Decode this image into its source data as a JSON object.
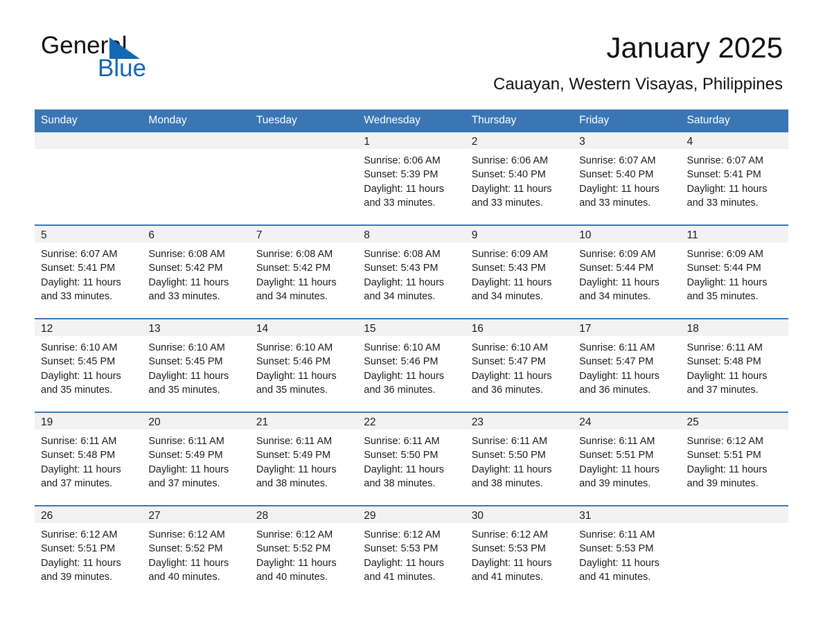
{
  "brand": {
    "name_part1": "General",
    "name_part2": "Blue",
    "accent_color": "#1268b3",
    "logo_icon": "triangle-icon"
  },
  "header": {
    "title": "January 2025",
    "subtitle": "Cauayan, Western Visayas, Philippines"
  },
  "theme": {
    "header_row_bg": "#3a76b4",
    "daynum_band_bg": "#f2f2f2",
    "row_divider": "#3a76b4"
  },
  "weekday_headers": [
    "Sunday",
    "Monday",
    "Tuesday",
    "Wednesday",
    "Thursday",
    "Friday",
    "Saturday"
  ],
  "weeks": [
    [
      {
        "day": "",
        "sunrise": "",
        "sunset": "",
        "daylight": "",
        "empty": true
      },
      {
        "day": "",
        "sunrise": "",
        "sunset": "",
        "daylight": "",
        "empty": true
      },
      {
        "day": "",
        "sunrise": "",
        "sunset": "",
        "daylight": "",
        "empty": true
      },
      {
        "day": "1",
        "sunrise": "Sunrise: 6:06 AM",
        "sunset": "Sunset: 5:39 PM",
        "daylight": "Daylight: 11 hours and 33 minutes."
      },
      {
        "day": "2",
        "sunrise": "Sunrise: 6:06 AM",
        "sunset": "Sunset: 5:40 PM",
        "daylight": "Daylight: 11 hours and 33 minutes."
      },
      {
        "day": "3",
        "sunrise": "Sunrise: 6:07 AM",
        "sunset": "Sunset: 5:40 PM",
        "daylight": "Daylight: 11 hours and 33 minutes."
      },
      {
        "day": "4",
        "sunrise": "Sunrise: 6:07 AM",
        "sunset": "Sunset: 5:41 PM",
        "daylight": "Daylight: 11 hours and 33 minutes."
      }
    ],
    [
      {
        "day": "5",
        "sunrise": "Sunrise: 6:07 AM",
        "sunset": "Sunset: 5:41 PM",
        "daylight": "Daylight: 11 hours and 33 minutes."
      },
      {
        "day": "6",
        "sunrise": "Sunrise: 6:08 AM",
        "sunset": "Sunset: 5:42 PM",
        "daylight": "Daylight: 11 hours and 33 minutes."
      },
      {
        "day": "7",
        "sunrise": "Sunrise: 6:08 AM",
        "sunset": "Sunset: 5:42 PM",
        "daylight": "Daylight: 11 hours and 34 minutes."
      },
      {
        "day": "8",
        "sunrise": "Sunrise: 6:08 AM",
        "sunset": "Sunset: 5:43 PM",
        "daylight": "Daylight: 11 hours and 34 minutes."
      },
      {
        "day": "9",
        "sunrise": "Sunrise: 6:09 AM",
        "sunset": "Sunset: 5:43 PM",
        "daylight": "Daylight: 11 hours and 34 minutes."
      },
      {
        "day": "10",
        "sunrise": "Sunrise: 6:09 AM",
        "sunset": "Sunset: 5:44 PM",
        "daylight": "Daylight: 11 hours and 34 minutes."
      },
      {
        "day": "11",
        "sunrise": "Sunrise: 6:09 AM",
        "sunset": "Sunset: 5:44 PM",
        "daylight": "Daylight: 11 hours and 35 minutes."
      }
    ],
    [
      {
        "day": "12",
        "sunrise": "Sunrise: 6:10 AM",
        "sunset": "Sunset: 5:45 PM",
        "daylight": "Daylight: 11 hours and 35 minutes."
      },
      {
        "day": "13",
        "sunrise": "Sunrise: 6:10 AM",
        "sunset": "Sunset: 5:45 PM",
        "daylight": "Daylight: 11 hours and 35 minutes."
      },
      {
        "day": "14",
        "sunrise": "Sunrise: 6:10 AM",
        "sunset": "Sunset: 5:46 PM",
        "daylight": "Daylight: 11 hours and 35 minutes."
      },
      {
        "day": "15",
        "sunrise": "Sunrise: 6:10 AM",
        "sunset": "Sunset: 5:46 PM",
        "daylight": "Daylight: 11 hours and 36 minutes."
      },
      {
        "day": "16",
        "sunrise": "Sunrise: 6:10 AM",
        "sunset": "Sunset: 5:47 PM",
        "daylight": "Daylight: 11 hours and 36 minutes."
      },
      {
        "day": "17",
        "sunrise": "Sunrise: 6:11 AM",
        "sunset": "Sunset: 5:47 PM",
        "daylight": "Daylight: 11 hours and 36 minutes."
      },
      {
        "day": "18",
        "sunrise": "Sunrise: 6:11 AM",
        "sunset": "Sunset: 5:48 PM",
        "daylight": "Daylight: 11 hours and 37 minutes."
      }
    ],
    [
      {
        "day": "19",
        "sunrise": "Sunrise: 6:11 AM",
        "sunset": "Sunset: 5:48 PM",
        "daylight": "Daylight: 11 hours and 37 minutes."
      },
      {
        "day": "20",
        "sunrise": "Sunrise: 6:11 AM",
        "sunset": "Sunset: 5:49 PM",
        "daylight": "Daylight: 11 hours and 37 minutes."
      },
      {
        "day": "21",
        "sunrise": "Sunrise: 6:11 AM",
        "sunset": "Sunset: 5:49 PM",
        "daylight": "Daylight: 11 hours and 38 minutes."
      },
      {
        "day": "22",
        "sunrise": "Sunrise: 6:11 AM",
        "sunset": "Sunset: 5:50 PM",
        "daylight": "Daylight: 11 hours and 38 minutes."
      },
      {
        "day": "23",
        "sunrise": "Sunrise: 6:11 AM",
        "sunset": "Sunset: 5:50 PM",
        "daylight": "Daylight: 11 hours and 38 minutes."
      },
      {
        "day": "24",
        "sunrise": "Sunrise: 6:11 AM",
        "sunset": "Sunset: 5:51 PM",
        "daylight": "Daylight: 11 hours and 39 minutes."
      },
      {
        "day": "25",
        "sunrise": "Sunrise: 6:12 AM",
        "sunset": "Sunset: 5:51 PM",
        "daylight": "Daylight: 11 hours and 39 minutes."
      }
    ],
    [
      {
        "day": "26",
        "sunrise": "Sunrise: 6:12 AM",
        "sunset": "Sunset: 5:51 PM",
        "daylight": "Daylight: 11 hours and 39 minutes."
      },
      {
        "day": "27",
        "sunrise": "Sunrise: 6:12 AM",
        "sunset": "Sunset: 5:52 PM",
        "daylight": "Daylight: 11 hours and 40 minutes."
      },
      {
        "day": "28",
        "sunrise": "Sunrise: 6:12 AM",
        "sunset": "Sunset: 5:52 PM",
        "daylight": "Daylight: 11 hours and 40 minutes."
      },
      {
        "day": "29",
        "sunrise": "Sunrise: 6:12 AM",
        "sunset": "Sunset: 5:53 PM",
        "daylight": "Daylight: 11 hours and 41 minutes."
      },
      {
        "day": "30",
        "sunrise": "Sunrise: 6:12 AM",
        "sunset": "Sunset: 5:53 PM",
        "daylight": "Daylight: 11 hours and 41 minutes."
      },
      {
        "day": "31",
        "sunrise": "Sunrise: 6:11 AM",
        "sunset": "Sunset: 5:53 PM",
        "daylight": "Daylight: 11 hours and 41 minutes."
      },
      {
        "day": "",
        "sunrise": "",
        "sunset": "",
        "daylight": "",
        "empty": true
      }
    ]
  ]
}
